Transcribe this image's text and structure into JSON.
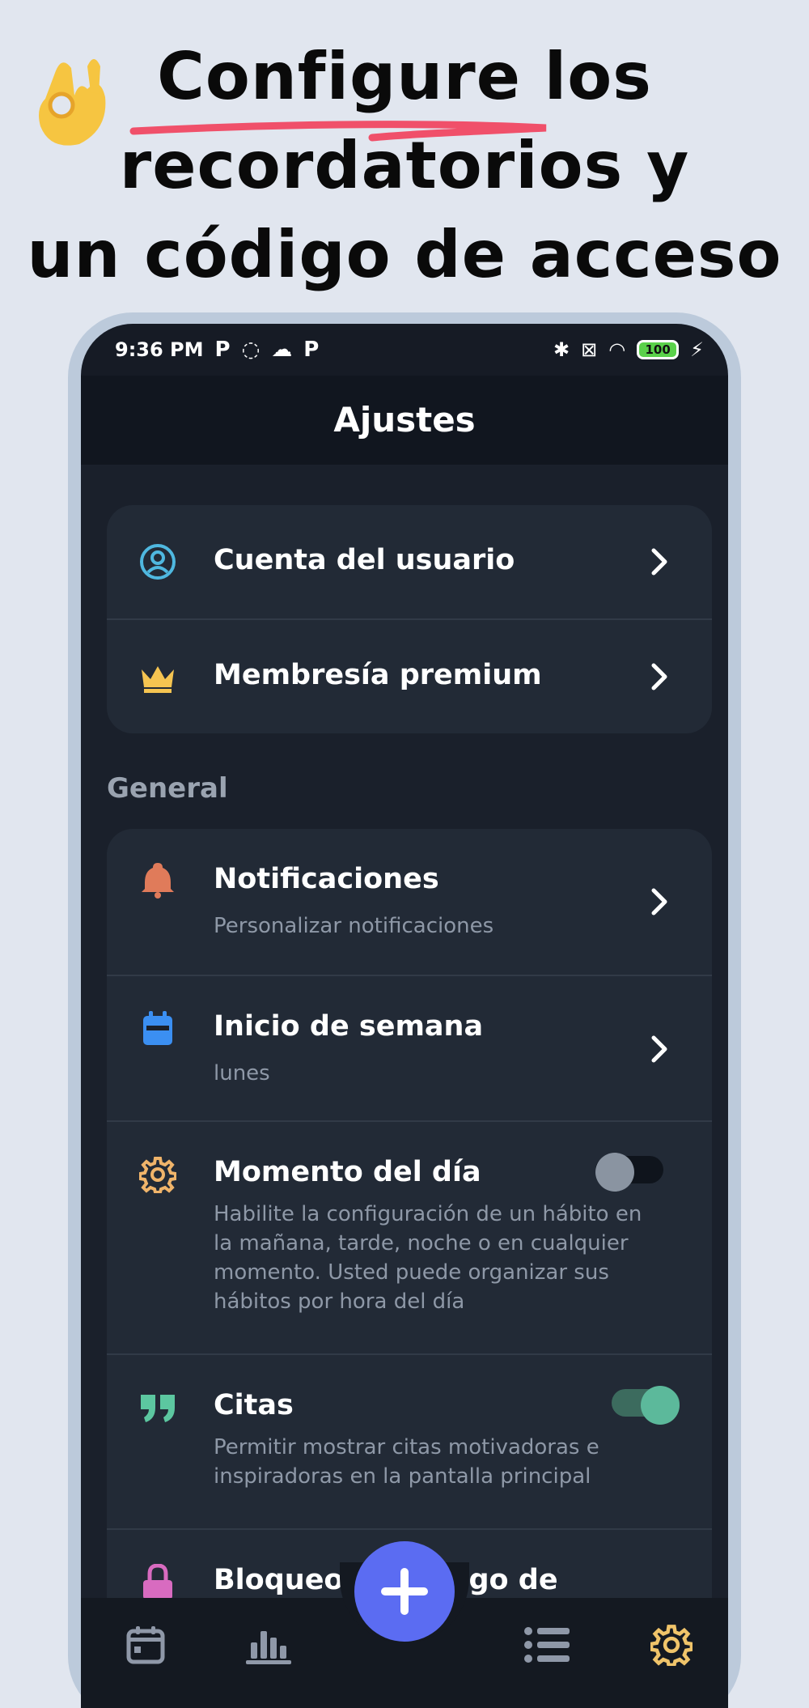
{
  "promo": {
    "headline_line1": "Configure los",
    "headline_line2": "recordatorios y",
    "headline_line3": "un código de acceso"
  },
  "statusbar": {
    "time": "9:36 PM",
    "battery": "100"
  },
  "header": {
    "title": "Ajustes"
  },
  "account_card": {
    "items": [
      {
        "label": "Cuenta del usuario",
        "icon": "user-circle-icon"
      },
      {
        "label": "Membresía premium",
        "icon": "crown-icon"
      }
    ]
  },
  "general": {
    "section_label": "General",
    "items": [
      {
        "label": "Notificaciones",
        "subtitle": "Personalizar notificaciones",
        "icon": "bell-icon"
      },
      {
        "label": "Inicio de semana",
        "subtitle": "lunes",
        "icon": "calendar-icon"
      },
      {
        "label": "Momento del día",
        "subtitle": "Habilite la configuración de un hábito en la mañana, tarde, noche o en cualquier momento. Usted puede organizar sus hábitos por hora del día",
        "icon": "gear-icon",
        "toggle_on": false
      },
      {
        "label": "Citas",
        "subtitle": "Permitir mostrar citas motivadoras e inspiradoras en la pantalla principal",
        "icon": "quote-icon",
        "toggle_on": true
      },
      {
        "label": "Bloqueo de código de",
        "icon": "lock-icon"
      }
    ]
  },
  "tabbar": {
    "tabs": [
      "calendar-tab",
      "stats-tab",
      "add-button",
      "list-tab",
      "settings-tab"
    ]
  },
  "colors": {
    "accent": "#5b6cf2",
    "toggle_on": "#5cb99b",
    "crown": "#f5c451",
    "bell": "#e07b5a",
    "calendar": "#3b8ff2",
    "gear": "#f0b46a",
    "quote": "#5cc7a0",
    "lock": "#d86bc0",
    "user": "#4fb8e0"
  }
}
